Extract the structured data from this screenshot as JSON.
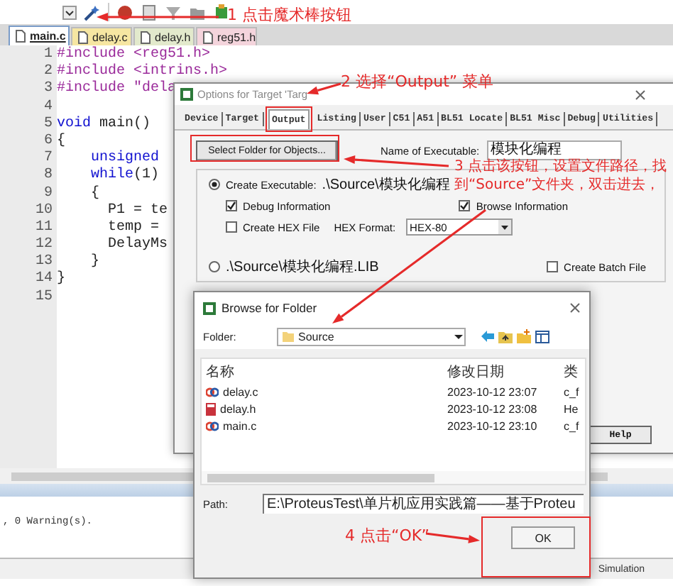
{
  "file_tabs": [
    {
      "label": "main.c",
      "selected": true,
      "color": "#ffffff"
    },
    {
      "label": "delay.c",
      "selected": false,
      "color": "#f6e6a2"
    },
    {
      "label": "delay.h",
      "selected": false,
      "color": "#e2e9cc"
    },
    {
      "label": "reg51.h",
      "selected": false,
      "color": "#f4d4dc"
    }
  ],
  "editor": {
    "lines": [
      {
        "number": "1",
        "segments": [
          {
            "text": "#include <reg51.h>",
            "kind": "directive"
          }
        ]
      },
      {
        "number": "2",
        "segments": [
          {
            "text": "#include <intrins.h>",
            "kind": "directive"
          }
        ]
      },
      {
        "number": "3",
        "segments": [
          {
            "text": "#include \"dela",
            "kind": "directive"
          }
        ]
      },
      {
        "number": "4"
      },
      {
        "number": "5",
        "segments": [
          {
            "text": "void",
            "kind": "keyword"
          },
          {
            "text": " main()",
            "kind": "plain"
          }
        ]
      },
      {
        "number": "6",
        "segments": [
          {
            "text": "{",
            "kind": "plain"
          }
        ]
      },
      {
        "number": "7",
        "segments": [
          {
            "text": "    unsigned",
            "kind": "keyword"
          }
        ]
      },
      {
        "number": "8",
        "segments": [
          {
            "text": "    while",
            "kind": "keyword"
          },
          {
            "text": "(1)",
            "kind": "plain"
          }
        ]
      },
      {
        "number": "9",
        "segments": [
          {
            "text": "    {",
            "kind": "plain"
          }
        ]
      },
      {
        "number": "10",
        "segments": [
          {
            "text": "      P1 = te",
            "kind": "plain"
          }
        ]
      },
      {
        "number": "11",
        "segments": [
          {
            "text": "      temp =",
            "kind": "plain"
          }
        ]
      },
      {
        "number": "12",
        "segments": [
          {
            "text": "      DelayMs",
            "kind": "plain"
          }
        ]
      },
      {
        "number": "13",
        "segments": [
          {
            "text": "    }",
            "kind": "plain"
          }
        ]
      },
      {
        "number": "14",
        "segments": [
          {
            "text": "}",
            "kind": "plain"
          }
        ]
      },
      {
        "number": "15"
      }
    ]
  },
  "output_panel": {
    "text": ", 0 Warning(s)."
  },
  "status_bar": {
    "mode": "Simulation"
  },
  "options_dialog": {
    "title": "Options for Target 'Targ",
    "tabs": [
      {
        "label": "Device",
        "selected": false
      },
      {
        "label": "Target",
        "selected": false
      },
      {
        "label": "Output",
        "selected": true
      },
      {
        "label": "Listing",
        "selected": false
      },
      {
        "label": "User",
        "selected": false
      },
      {
        "label": "C51",
        "selected": false
      },
      {
        "label": "A51",
        "selected": false
      },
      {
        "label": "BL51 Locate",
        "selected": false
      },
      {
        "label": "BL51 Misc",
        "selected": false
      },
      {
        "label": "Debug",
        "selected": false
      },
      {
        "label": "Utilities",
        "selected": false
      }
    ],
    "select_folder_button": "Select Folder for Objects...",
    "name_label": "Name of Executable:",
    "name_value": "模块化编程",
    "create_executable": {
      "label": "Create Executable:",
      "path": ".\\Source\\模块化编程",
      "selected": true
    },
    "options": [
      {
        "label": "Debug Information",
        "checked": true
      },
      {
        "label": "Browse Information",
        "checked": true
      },
      {
        "label": "Create HEX File",
        "checked": false
      }
    ],
    "hex_format_label": "HEX Format:",
    "hex_format_value": "HEX-80",
    "create_library": {
      "label": ".\\Source\\模块化编程.LIB",
      "selected": false
    },
    "create_batch": {
      "label": "Create Batch File",
      "checked": false
    },
    "help_button": "Help"
  },
  "browse_dialog": {
    "title": "Browse for Folder",
    "folder_label": "Folder:",
    "folder_value": "Source",
    "columns": [
      "名称",
      "修改日期",
      "类"
    ],
    "rows": [
      {
        "kind": "c",
        "name": "delay.c",
        "date": "2023-10-12 23:07",
        "type": "c_f"
      },
      {
        "kind": "h",
        "name": "delay.h",
        "date": "2023-10-12 23:08",
        "type": "He"
      },
      {
        "kind": "c",
        "name": "main.c",
        "date": "2023-10-12 23:10",
        "type": "c_f"
      }
    ],
    "path_label": "Path:",
    "path_value": "E:\\ProteusTest\\单片机应用实践篇——基于Proteu",
    "ok_button": "OK"
  },
  "annotations": [
    {
      "text": "1 点击魔术棒按钮"
    },
    {
      "text": "2 选择“Output” 菜单"
    },
    {
      "text": "3 点击该按钮，设置文件路径，找到“Source”文件夹，双击进去，"
    },
    {
      "text": "4 点击“OK”"
    }
  ]
}
